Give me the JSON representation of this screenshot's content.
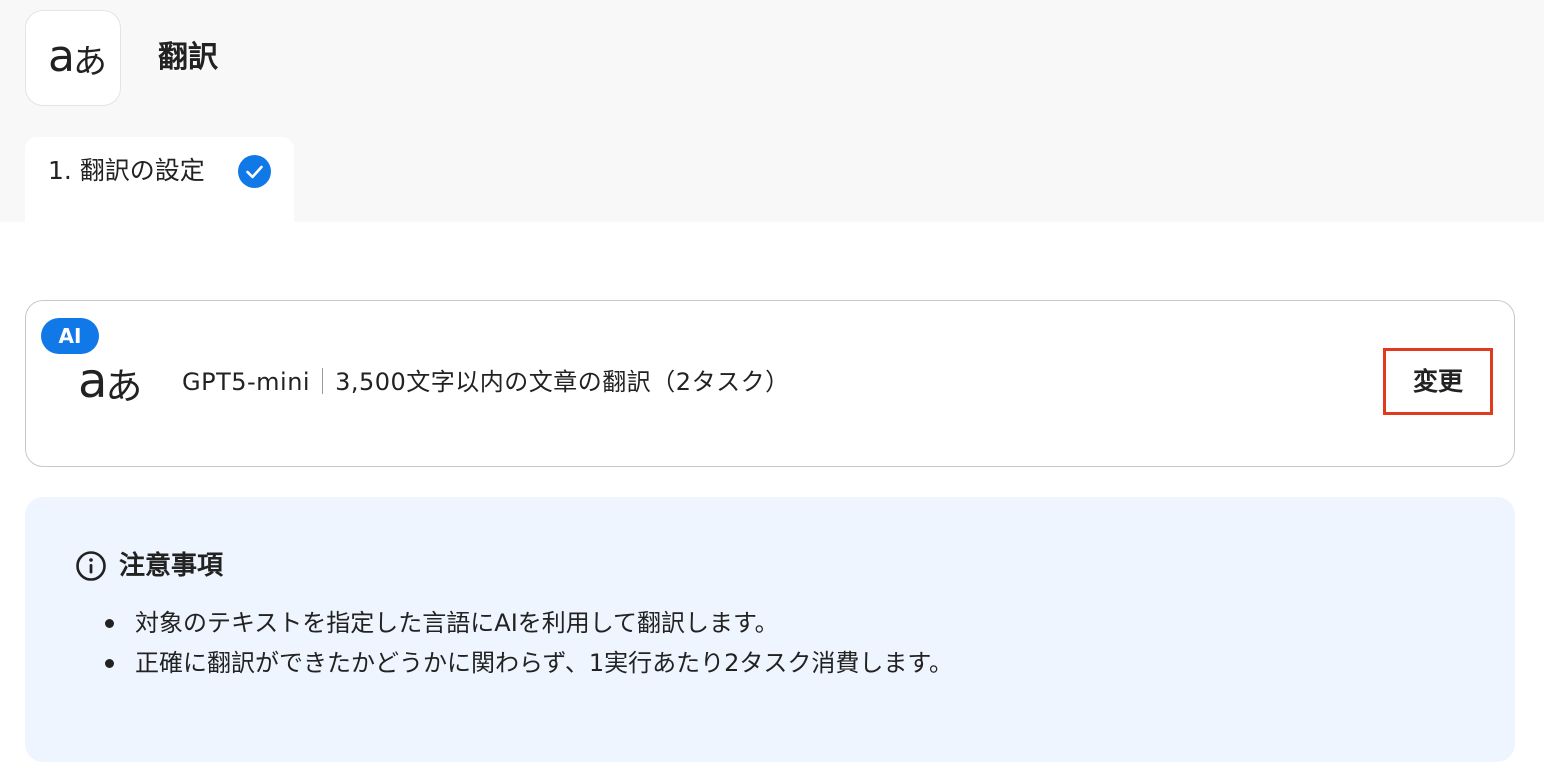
{
  "app": {
    "icon_latin": "a",
    "icon_kana": "あ",
    "title": "翻訳"
  },
  "tabs": [
    {
      "label": "1. 翻訳の設定",
      "completed": true
    }
  ],
  "model": {
    "badge": "AI",
    "name": "GPT5-mini",
    "description": "3,500文字以内の文章の翻訳（2タスク）",
    "change_label": "変更"
  },
  "notice": {
    "title": "注意事項",
    "items": [
      "対象のテキストを指定した言語にAIを利用して翻訳します。",
      "正確に翻訳ができたかどうかに関わらず、1実行あたり2タスク消費します。"
    ]
  },
  "colors": {
    "accent": "#1178e8",
    "highlight_border": "#e23a1c",
    "notice_bg": "#eef5fe",
    "top_bg": "#f8f8f8"
  }
}
